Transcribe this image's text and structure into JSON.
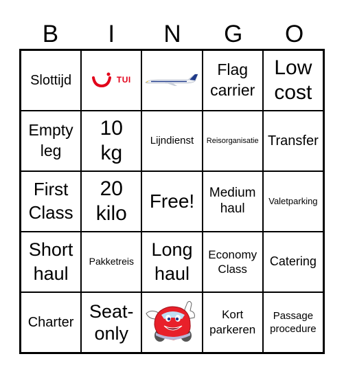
{
  "header": [
    "B",
    "I",
    "N",
    "G",
    "O"
  ],
  "colors": {
    "grid": "#000000",
    "tui_red": "#e2001a",
    "car_red": "#e8202a"
  },
  "cells": [
    [
      "Slottijd",
      "TUI",
      "ryanair-plane-image",
      "Flag carrier",
      "Low cost"
    ],
    [
      "Empty leg",
      "10 kg",
      "Lijndienst",
      "Reisorganisatie",
      "Transfer"
    ],
    [
      "First Class",
      "20 kilo",
      "Free!",
      "Medium haul",
      "Valetparking"
    ],
    [
      "Short haul",
      "Pakketreis",
      "Long haul",
      "Economy Class",
      "Catering"
    ],
    [
      "Charter",
      "Seat-only",
      "cartoon-car-image",
      "Kort parkeren",
      "Passage procedure"
    ]
  ],
  "labels": {
    "r0c0": "Slottijd",
    "r0c1": "TUI",
    "r0c3a": "Flag",
    "r0c3b": "carrier",
    "r0c4a": "Low",
    "r0c4b": "cost",
    "r1c0a": "Empty",
    "r1c0b": "leg",
    "r1c1a": "10",
    "r1c1b": "kg",
    "r1c2": "Lijndienst",
    "r1c3": "Reisorganisatie",
    "r1c4": "Transfer",
    "r2c0a": "First",
    "r2c0b": "Class",
    "r2c1a": "20",
    "r2c1b": "kilo",
    "r2c2": "Free!",
    "r2c3a": "Medium",
    "r2c3b": "haul",
    "r2c4": "Valetparking",
    "r3c0a": "Short",
    "r3c0b": "haul",
    "r3c1": "Pakketreis",
    "r3c2a": "Long",
    "r3c2b": "haul",
    "r3c3a": "Economy",
    "r3c3b": "Class",
    "r3c4": "Catering",
    "r4c0": "Charter",
    "r4c1a": "Seat-",
    "r4c1b": "only",
    "r4c3a": "Kort",
    "r4c3b": "parkeren",
    "r4c4a": "Passage",
    "r4c4b": "procedure"
  }
}
